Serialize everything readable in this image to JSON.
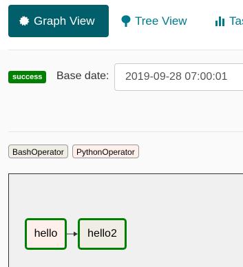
{
  "tabs": [
    {
      "label": "Graph View",
      "icon": "certificate-icon",
      "active": true
    },
    {
      "label": "Tree View",
      "icon": "tree-icon",
      "active": false
    },
    {
      "label": "Task Duration",
      "icon": "bar-chart-icon",
      "active": false
    }
  ],
  "state_badge": "success",
  "base_date": {
    "label": "Base date:",
    "value": "2019-09-28 07:00:01"
  },
  "legend": [
    {
      "label": "BashOperator",
      "color": "#f0ede4"
    },
    {
      "label": "PythonOperator",
      "color": "#ffefeb"
    }
  ],
  "graph": {
    "nodes": [
      {
        "id": "hello",
        "label": "hello",
        "operator": "PythonOperator",
        "state_color": "#008000"
      },
      {
        "id": "hello2",
        "label": "hello2",
        "operator": "BashOperator",
        "state_color": "#008000"
      }
    ],
    "edges": [
      {
        "from": "hello",
        "to": "hello2"
      }
    ]
  },
  "colors": {
    "active_tab": "#005f6a",
    "success": "#008000"
  }
}
